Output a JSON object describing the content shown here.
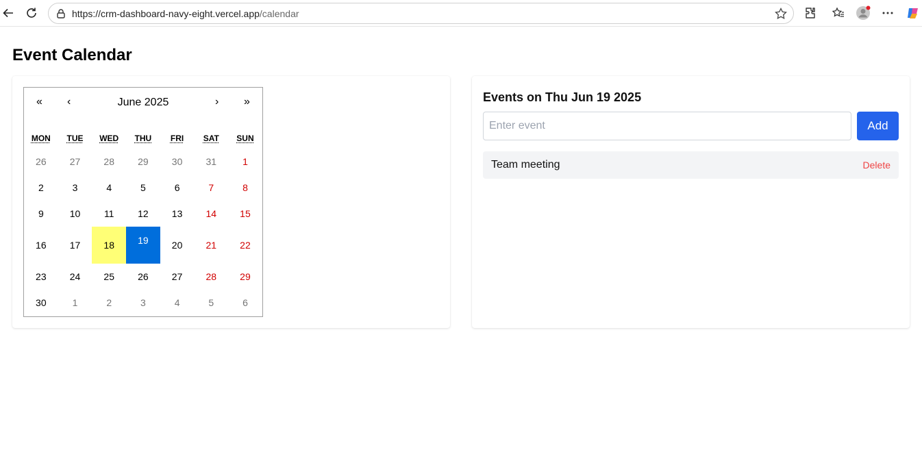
{
  "browser": {
    "url_host": "https://crm-dashboard-navy-eight.vercel.app",
    "url_path": "/calendar"
  },
  "page": {
    "title": "Event Calendar"
  },
  "calendar": {
    "nav": {
      "prev_year": "«",
      "prev_month": "‹",
      "label": "June 2025",
      "next_month": "›",
      "next_year": "»"
    },
    "weekdays": [
      "MON",
      "TUE",
      "WED",
      "THU",
      "FRI",
      "SAT",
      "SUN"
    ],
    "weeks": [
      [
        {
          "d": "26",
          "t": "muted"
        },
        {
          "d": "27",
          "t": "muted"
        },
        {
          "d": "28",
          "t": "muted"
        },
        {
          "d": "29",
          "t": "muted"
        },
        {
          "d": "30",
          "t": "muted"
        },
        {
          "d": "31",
          "t": "muted"
        },
        {
          "d": "1",
          "t": "weekend"
        }
      ],
      [
        {
          "d": "2",
          "t": "normal"
        },
        {
          "d": "3",
          "t": "normal"
        },
        {
          "d": "4",
          "t": "normal"
        },
        {
          "d": "5",
          "t": "normal"
        },
        {
          "d": "6",
          "t": "normal"
        },
        {
          "d": "7",
          "t": "weekend"
        },
        {
          "d": "8",
          "t": "weekend"
        }
      ],
      [
        {
          "d": "9",
          "t": "normal"
        },
        {
          "d": "10",
          "t": "normal"
        },
        {
          "d": "11",
          "t": "normal"
        },
        {
          "d": "12",
          "t": "normal"
        },
        {
          "d": "13",
          "t": "normal"
        },
        {
          "d": "14",
          "t": "weekend"
        },
        {
          "d": "15",
          "t": "weekend"
        }
      ],
      [
        {
          "d": "16",
          "t": "normal"
        },
        {
          "d": "17",
          "t": "normal"
        },
        {
          "d": "18",
          "t": "today"
        },
        {
          "d": "19",
          "t": "selected"
        },
        {
          "d": "20",
          "t": "normal"
        },
        {
          "d": "21",
          "t": "weekend"
        },
        {
          "d": "22",
          "t": "weekend"
        }
      ],
      [
        {
          "d": "23",
          "t": "normal"
        },
        {
          "d": "24",
          "t": "normal"
        },
        {
          "d": "25",
          "t": "normal"
        },
        {
          "d": "26",
          "t": "normal"
        },
        {
          "d": "27",
          "t": "normal"
        },
        {
          "d": "28",
          "t": "weekend"
        },
        {
          "d": "29",
          "t": "weekend"
        }
      ],
      [
        {
          "d": "30",
          "t": "normal"
        },
        {
          "d": "1",
          "t": "muted"
        },
        {
          "d": "2",
          "t": "muted"
        },
        {
          "d": "3",
          "t": "muted"
        },
        {
          "d": "4",
          "t": "muted"
        },
        {
          "d": "5",
          "t": "muted"
        },
        {
          "d": "6",
          "t": "muted"
        }
      ]
    ]
  },
  "events": {
    "heading": "Events on Thu Jun 19 2025",
    "input_placeholder": "Enter event",
    "input_value": "",
    "add_label": "Add",
    "items": [
      {
        "name": "Team meeting",
        "delete_label": "Delete"
      }
    ]
  },
  "colors": {
    "accent": "#2563eb",
    "selected_day": "#006edc",
    "today": "#ffff76",
    "weekend": "#d10000",
    "delete": "#ef4444"
  }
}
